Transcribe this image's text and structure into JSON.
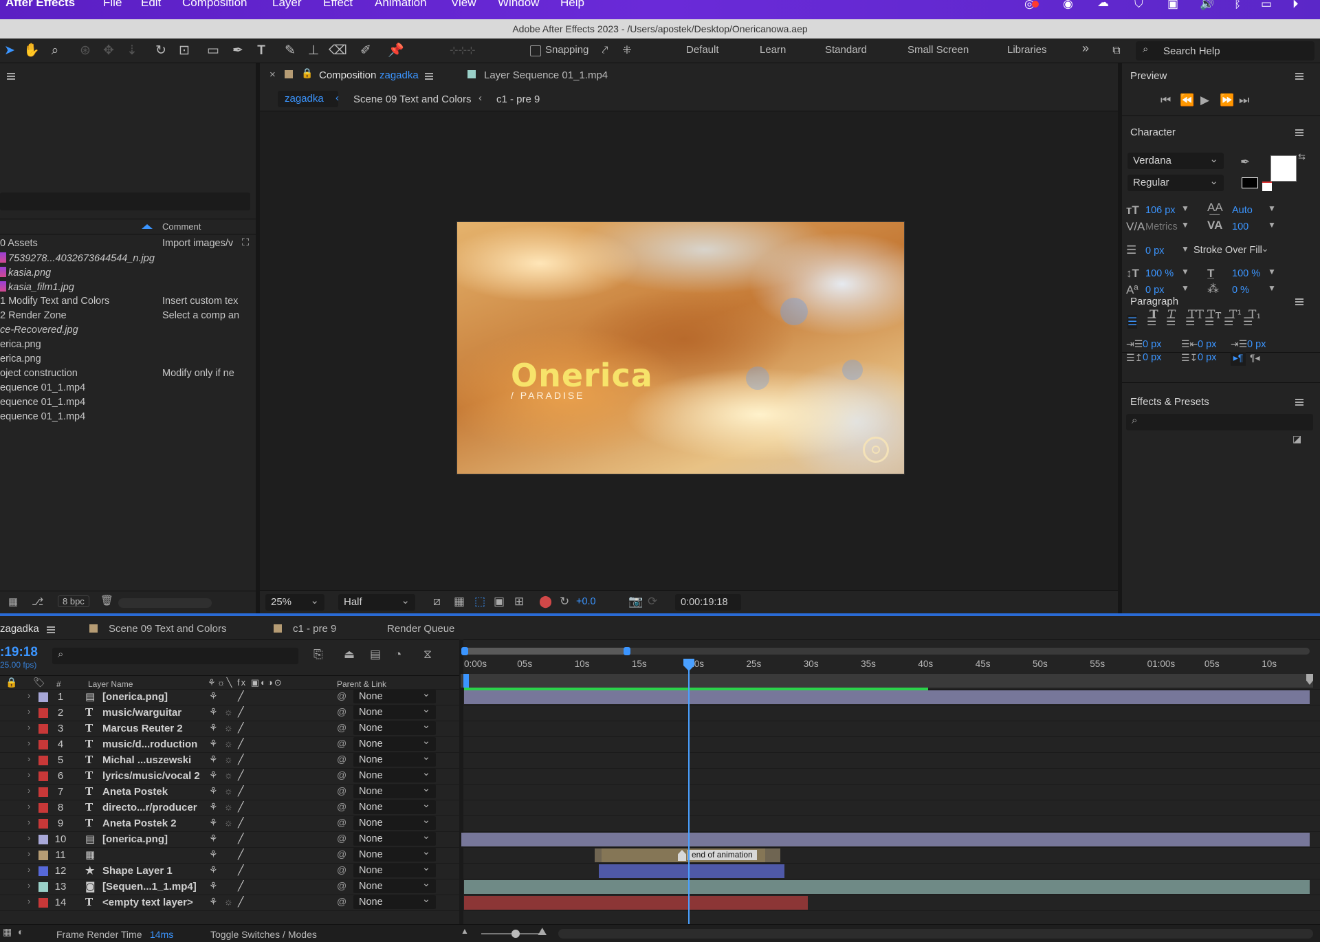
{
  "menubar": {
    "app": "After Effects",
    "items": [
      "File",
      "Edit",
      "Composition",
      "Layer",
      "Effect",
      "Animation",
      "View",
      "Window",
      "Help"
    ]
  },
  "window_title": "Adobe After Effects 2023 - /Users/apostek/Desktop/Onericanowa.aep",
  "toolbar": {
    "snapping_label": "Snapping",
    "workspaces": [
      "Default",
      "Learn",
      "Standard",
      "Small Screen",
      "Libraries"
    ],
    "overflow": "»",
    "search_placeholder": "Search Help"
  },
  "project": {
    "comment_header": "Comment",
    "rows": [
      {
        "name": "0 Assets",
        "comment": "Import images/v",
        "file": false
      },
      {
        "name": "7539278...4032673644544_n.jpg",
        "comment": "",
        "file": true
      },
      {
        "name": "kasia.png",
        "comment": "",
        "file": true
      },
      {
        "name": "kasia_film1.jpg",
        "comment": "",
        "file": true
      },
      {
        "name": "1 Modify Text and Colors",
        "comment": "Insert custom tex",
        "file": false
      },
      {
        "name": "2 Render Zone",
        "comment": "Select a comp an",
        "file": false
      },
      {
        "name": "ce-Recovered.jpg",
        "comment": "",
        "file": false,
        "italic": true
      },
      {
        "name": "erica.png",
        "comment": "",
        "file": false
      },
      {
        "name": "erica.png",
        "comment": "",
        "file": false
      },
      {
        "name": "oject construction",
        "comment": "Modify only if ne",
        "file": false
      },
      {
        "name": "equence 01_1.mp4",
        "comment": "",
        "file": false
      },
      {
        "name": "equence 01_1.mp4",
        "comment": "",
        "file": false
      },
      {
        "name": "equence 01_1.mp4",
        "comment": "",
        "file": false
      }
    ],
    "bpc": "8 bpc"
  },
  "comp_viewer": {
    "tab_prefix": "Composition",
    "tab_comp": "zagadka",
    "tab_footage": "Layer Sequence 01_1.mp4",
    "breadcrumbs": [
      "zagadka",
      "Scene 09 Text and Colors",
      "c1 - pre 9"
    ],
    "frame_title": "Onerica",
    "frame_subtitle": "PARADISE",
    "zoom": "25%",
    "resolution": "Half",
    "exposure": "+0.0",
    "timecode": "0:00:19:18"
  },
  "preview": {
    "title": "Preview"
  },
  "character": {
    "title": "Character",
    "font": "Verdana",
    "style": "Regular",
    "size": "106 px",
    "leading": "Auto",
    "kerning": "Metrics",
    "tracking": "100",
    "stroke_width": "0 px",
    "stroke_mode": "Stroke Over Fill",
    "vscale": "100 %",
    "hscale": "100 %",
    "baseline": "0 px",
    "tsume": "0 %",
    "styles": [
      "T",
      "T",
      "TT",
      "Tт",
      "T¹",
      "T₁"
    ]
  },
  "paragraph": {
    "title": "Paragraph",
    "indent_left": "0 px",
    "indent_first": "0 px",
    "indent_right": "0 px",
    "space_before": "0 px",
    "space_after": "0 px"
  },
  "effects": {
    "title": "Effects & Presets"
  },
  "timeline": {
    "tabs": [
      "zagadka",
      "Scene 09 Text and Colors",
      "c1 - pre 9",
      "Render Queue"
    ],
    "timecode": ":19:18",
    "fps": "25.00 fps)",
    "col_layer_name": "Layer Name",
    "col_parent": "Parent & Link",
    "col_num": "#",
    "ruler": [
      "0:00s",
      "05s",
      "10s",
      "15s",
      "20s",
      "25s",
      "30s",
      "35s",
      "40s",
      "45s",
      "50s",
      "55s",
      "01:00s",
      "05s",
      "10s"
    ],
    "layers": [
      {
        "num": "1",
        "type": "file",
        "name": "[onerica.png]",
        "label": "#a8a8d8",
        "parent": "None"
      },
      {
        "num": "2",
        "type": "T",
        "name": "music/warguitar",
        "label": "#c83838",
        "parent": "None"
      },
      {
        "num": "3",
        "type": "T",
        "name": "Marcus Reuter 2",
        "label": "#c83838",
        "parent": "None"
      },
      {
        "num": "4",
        "type": "T",
        "name": "music/d...roduction",
        "label": "#c83838",
        "parent": "None"
      },
      {
        "num": "5",
        "type": "T",
        "name": "Michal ...uszewski",
        "label": "#c83838",
        "parent": "None"
      },
      {
        "num": "6",
        "type": "T",
        "name": "lyrics/music/vocal 2",
        "label": "#c83838",
        "parent": "None"
      },
      {
        "num": "7",
        "type": "T",
        "name": "Aneta Postek",
        "label": "#c83838",
        "parent": "None"
      },
      {
        "num": "8",
        "type": "T",
        "name": "directo...r/producer",
        "label": "#c83838",
        "parent": "None"
      },
      {
        "num": "9",
        "type": "T",
        "name": "Aneta Postek 2",
        "label": "#c83838",
        "parent": "None"
      },
      {
        "num": "10",
        "type": "file",
        "name": "[onerica.png]",
        "label": "#a8a8d8",
        "parent": "None"
      },
      {
        "num": "11",
        "type": "comp",
        "name": "",
        "label": "#b69c74",
        "parent": "None"
      },
      {
        "num": "12",
        "type": "star",
        "name": "Shape Layer 1",
        "label": "#5668d8",
        "parent": "None"
      },
      {
        "num": "13",
        "type": "video",
        "name": "[Sequen...1_1.mp4]",
        "label": "#9ad0c8",
        "parent": "None"
      },
      {
        "num": "14",
        "type": "T",
        "name": "<empty text layer>",
        "label": "#c83838",
        "parent": "None"
      }
    ],
    "marker_label": "end of animation",
    "footer_render_label": "Frame Render Time",
    "footer_render_value": "14ms",
    "footer_toggle": "Toggle Switches / Modes"
  },
  "colors": {
    "accent": "#3b95ff",
    "menubar": "#6a2ad8",
    "logo_yellow": "#f7e36a",
    "playhead": "#4aa0ff"
  }
}
